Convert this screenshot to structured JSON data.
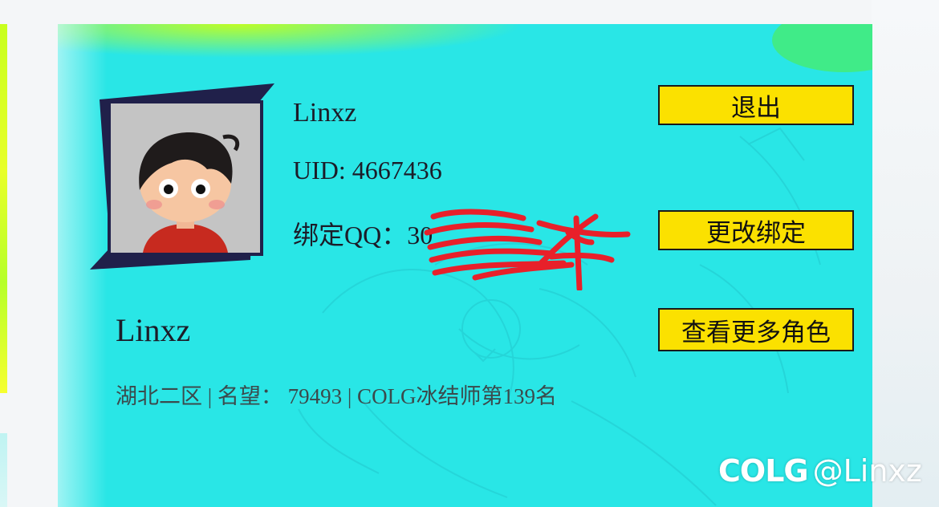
{
  "profile": {
    "username": "Linxz",
    "uid_text": "UID: 4667436",
    "qq_label": "绑定QQ：",
    "qq_value_visible": "30"
  },
  "buttons": {
    "logout": "退出",
    "rebind": "更改绑定",
    "more_roles": "查看更多角色"
  },
  "character": {
    "name": "Linxz",
    "meta": "湖北二区 | 名望： 79493 | COLG冰结师第139名"
  },
  "watermark": {
    "logo": "COLG",
    "handle": "@Linxz"
  },
  "colors": {
    "card_bg": "#29e6e6",
    "button_bg": "#fbe100",
    "redaction": "#e8202a"
  },
  "icons": {
    "avatar": "cartoon-boy-avatar",
    "redaction": "red-scribble"
  }
}
